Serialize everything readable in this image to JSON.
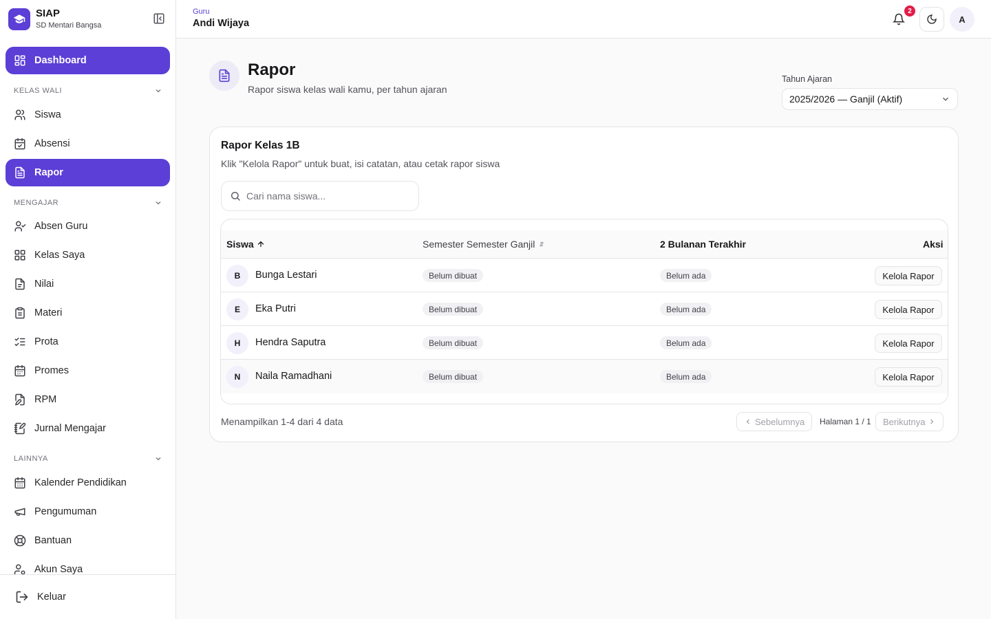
{
  "brand": {
    "name": "SIAP",
    "school": "SD Mentari Bangsa"
  },
  "sidebar": {
    "dashboard": "Dashboard",
    "sections": [
      {
        "title": "KELAS WALI",
        "items": [
          "Siswa",
          "Absensi",
          "Rapor"
        ]
      },
      {
        "title": "MENGAJAR",
        "items": [
          "Absen Guru",
          "Kelas Saya",
          "Nilai",
          "Materi",
          "Prota",
          "Promes",
          "RPM",
          "Jurnal Mengajar"
        ]
      },
      {
        "title": "LAINNYA",
        "items": [
          "Kalender Pendidikan",
          "Pengumuman",
          "Bantuan",
          "Akun Saya"
        ]
      }
    ],
    "active": "Rapor",
    "logout": "Keluar"
  },
  "topbar": {
    "role": "Guru",
    "user_name": "Andi Wijaya",
    "notification_count": "2",
    "avatar_initial": "A"
  },
  "page": {
    "title": "Rapor",
    "subtitle": "Rapor siswa kelas wali kamu, per tahun ajaran",
    "year_label": "Tahun Ajaran",
    "year_value": "2025/2026 — Ganjil (Aktif)"
  },
  "card": {
    "title": "Rapor Kelas 1B",
    "description": "Klik \"Kelola Rapor\" untuk buat, isi catatan, atau cetak rapor siswa",
    "search_placeholder": "Cari nama siswa..."
  },
  "table": {
    "columns": [
      "Siswa",
      "Semester Semester Ganjil",
      "2 Bulanan Terakhir",
      "Aksi"
    ],
    "rows": [
      {
        "initial": "B",
        "name": "Bunga Lestari",
        "semester": "Belum dibuat",
        "bulanan": "Belum ada",
        "action": "Kelola Rapor"
      },
      {
        "initial": "E",
        "name": "Eka Putri",
        "semester": "Belum dibuat",
        "bulanan": "Belum ada",
        "action": "Kelola Rapor"
      },
      {
        "initial": "H",
        "name": "Hendra Saputra",
        "semester": "Belum dibuat",
        "bulanan": "Belum ada",
        "action": "Kelola Rapor"
      },
      {
        "initial": "N",
        "name": "Naila Ramadhani",
        "semester": "Belum dibuat",
        "bulanan": "Belum ada",
        "action": "Kelola Rapor"
      }
    ]
  },
  "pagination": {
    "summary": "Menampilkan 1-4 dari 4 data",
    "prev": "Sebelumnya",
    "page_info": "Halaman 1 / 1",
    "next": "Berikutnya"
  },
  "colors": {
    "accent": "#5b3fd6",
    "badge": "#e11d48"
  },
  "icons": {
    "dashboard": "layout-grid-icon",
    "siswa": "users-icon",
    "absensi": "calendar-check-icon",
    "rapor": "file-text-icon",
    "absen_guru": "user-check-icon",
    "kelas_saya": "layout-grid-icon",
    "nilai": "file-icon",
    "materi": "clipboard-icon",
    "prota": "list-checks-icon",
    "promes": "calendar-icon",
    "rpm": "file-edit-icon",
    "jurnal": "notebook-pen-icon",
    "kalender": "calendar-days-icon",
    "pengumuman": "megaphone-icon",
    "bantuan": "life-buoy-icon",
    "akun": "user-cog-icon",
    "keluar": "log-out-icon"
  }
}
